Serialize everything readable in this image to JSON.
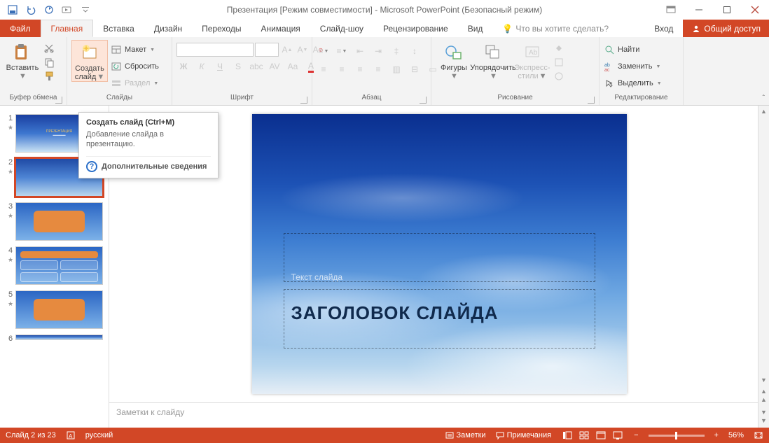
{
  "window": {
    "title": "Презентация [Режим совместимости] - Microsoft PowerPoint (Безопасный режим)"
  },
  "tabs": {
    "file": "Файл",
    "home": "Главная",
    "insert": "Вставка",
    "design": "Дизайн",
    "transitions": "Переходы",
    "animation": "Анимация",
    "slideshow": "Слайд-шоу",
    "review": "Рецензирование",
    "view": "Вид",
    "tell_me": "Что вы хотите сделать?",
    "signin": "Вход",
    "share": "Общий доступ"
  },
  "ribbon": {
    "clipboard": {
      "label": "Буфер обмена",
      "paste": "Вставить"
    },
    "slides": {
      "label": "Слайды",
      "new_slide_l1": "Создать",
      "new_slide_l2": "слайд",
      "layout": "Макет",
      "reset": "Сбросить",
      "section": "Раздел"
    },
    "font": {
      "label": "Шрифт"
    },
    "paragraph": {
      "label": "Абзац"
    },
    "drawing": {
      "label": "Рисование",
      "shapes": "Фигуры",
      "arrange": "Упорядочить",
      "styles_l1": "Экспресс-",
      "styles_l2": "стили"
    },
    "editing": {
      "label": "Редактирование",
      "find": "Найти",
      "replace": "Заменить",
      "select": "Выделить"
    }
  },
  "tooltip": {
    "title": "Создать слайд (Ctrl+M)",
    "desc": "Добавление слайда в презентацию.",
    "more": "Дополнительные сведения"
  },
  "slide": {
    "subtitle_ph": "Текст слайда",
    "title_ph": "ЗАГОЛОВОК СЛАЙДА"
  },
  "notes_placeholder": "Заметки к слайду",
  "status": {
    "slide_of": "Слайд 2 из 23",
    "lang": "русский",
    "notes": "Заметки",
    "comments": "Примечания",
    "zoom": "56%"
  },
  "thumbs": [
    "1",
    "2",
    "3",
    "4",
    "5",
    "6"
  ]
}
